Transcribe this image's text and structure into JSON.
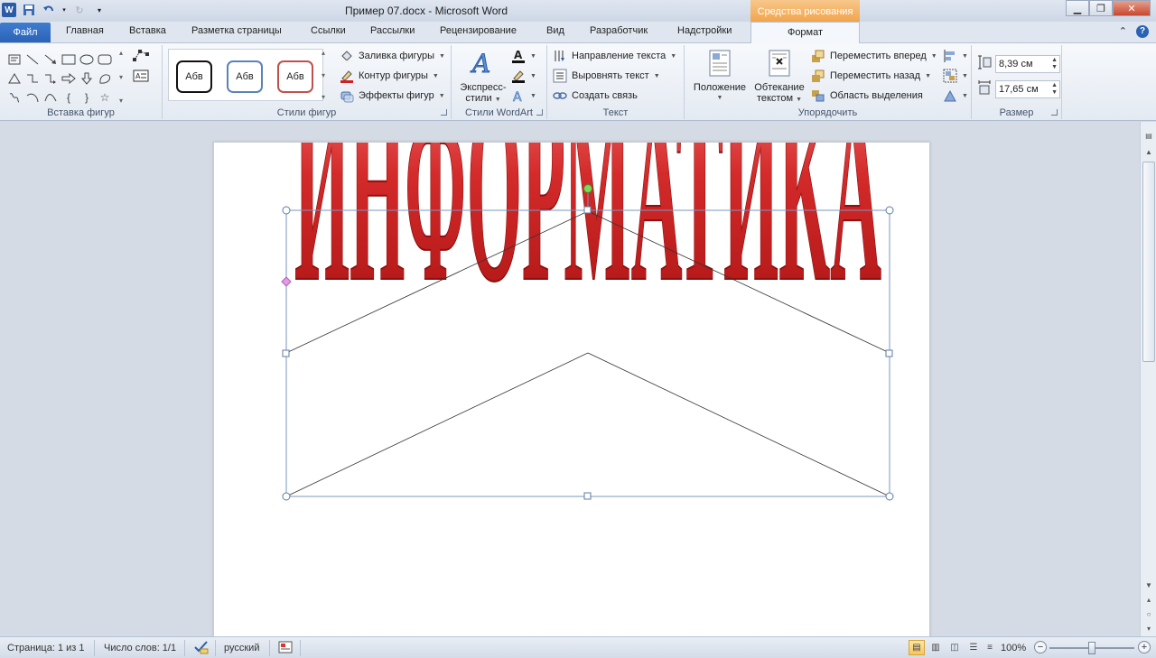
{
  "window": {
    "title": "Пример 07.docx  -  Microsoft Word",
    "contextual_tab_title": "Средства рисования",
    "buttons": [
      "minimize",
      "restore",
      "close"
    ]
  },
  "tabs": {
    "file": "Файл",
    "items": [
      "Главная",
      "Вставка",
      "Разметка страницы",
      "Ссылки",
      "Рассылки",
      "Рецензирование",
      "Вид",
      "Разработчик",
      "Надстройки"
    ],
    "active": "Формат"
  },
  "ribbon": {
    "insert_shapes": {
      "label": "Вставка фигур"
    },
    "shape_styles": {
      "label": "Стили фигур",
      "preset_text": "Абв",
      "fill": "Заливка фигуры",
      "outline": "Контур фигуры",
      "effects": "Эффекты фигур"
    },
    "wordart_styles": {
      "label": "Стили WordArt",
      "express_line1": "Экспресс-",
      "express_line2": "стили"
    },
    "text": {
      "label": "Текст",
      "direction": "Направление текста",
      "align": "Выровнять текст",
      "link": "Создать связь"
    },
    "arrange": {
      "label": "Упорядочить",
      "position": "Положение",
      "wrap_line1": "Обтекание",
      "wrap_line2": "текстом",
      "bring_forward": "Переместить вперед",
      "send_backward": "Переместить назад",
      "selection_pane": "Область выделения"
    },
    "size": {
      "label": "Размер",
      "height": "8,39 см",
      "width": "17,65 см"
    }
  },
  "document": {
    "wordart_text": "ИНФОРМАТИКА",
    "wordart_color": "#d42a2a"
  },
  "statusbar": {
    "page": "Страница: 1 из 1",
    "words": "Число слов: 1/1",
    "language": "русский",
    "zoom": "100%",
    "zoom_fraction": 0.5
  }
}
